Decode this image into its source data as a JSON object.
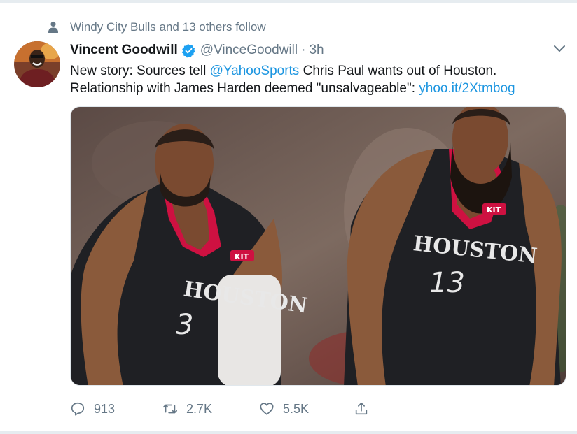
{
  "social_context": {
    "text": "Windy City Bulls and 13 others follow",
    "icon": "person-icon"
  },
  "tweet": {
    "author": {
      "display_name": "Vincent Goodwill",
      "handle": "@VinceGoodwill",
      "verified": true
    },
    "separator": "·",
    "timestamp": "3h",
    "text": {
      "line1_pre": "New story: Sources tell ",
      "mention": "@YahooSports",
      "line1_post": " Chris Paul wants out of Houston.",
      "line2_pre": "Relationship with James Harden deemed \"unsalvageable\": ",
      "link": "yhoo.it/2Xtmbog"
    },
    "media": {
      "player_left": {
        "team": "HOUSTON",
        "number": "3"
      },
      "player_right": {
        "team": "HOUSTON",
        "number": "13"
      },
      "patch": "KIT"
    },
    "actions": {
      "reply_count": "913",
      "retweet_count": "2.7K",
      "like_count": "5.5K"
    }
  },
  "colors": {
    "link": "#1b95e0",
    "secondary_text": "#657786",
    "primary_text": "#14171a",
    "verified": "#1da1f2",
    "jersey": "#1f2024",
    "jersey_trim": "#ce1141"
  }
}
